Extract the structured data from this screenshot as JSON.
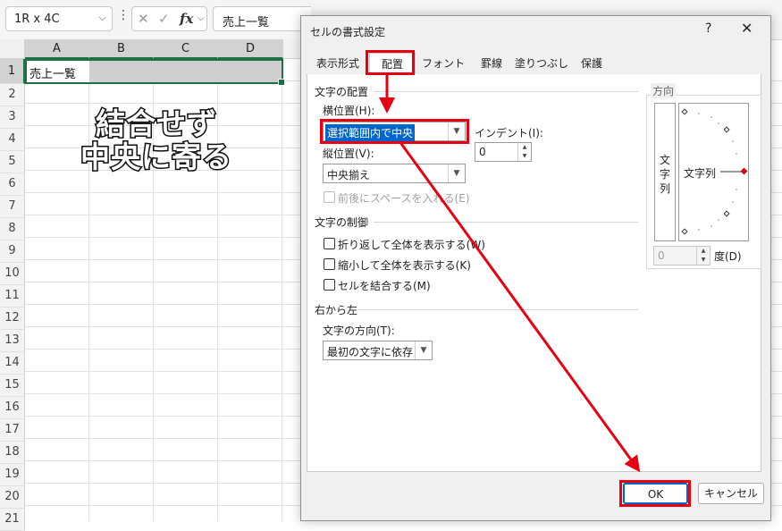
{
  "formula_bar": {
    "name_box": "1R x 4C",
    "more_icon": "⋮",
    "cancel_icon": "✕",
    "enter_icon": "✓",
    "fx": "fx",
    "formula": "売上一覧"
  },
  "sheet": {
    "columns": [
      "A",
      "B",
      "C",
      "D"
    ],
    "rows": [
      "1",
      "2",
      "3",
      "4",
      "5",
      "6",
      "7",
      "8",
      "9",
      "10",
      "11",
      "12",
      "13",
      "14",
      "15",
      "16",
      "17",
      "18",
      "19",
      "20",
      "21"
    ],
    "cell_a1": "売上一覧"
  },
  "annotation": {
    "line1": "結合せず",
    "line2": "中央に寄る"
  },
  "dialog": {
    "title": "セルの書式設定",
    "help": "?",
    "close": "✕",
    "tabs": [
      "表示形式",
      "配置",
      "フォント",
      "罫線",
      "塗りつぶし",
      "保護"
    ],
    "active_tab": "配置",
    "text_alignment": {
      "section": "文字の配置",
      "horizontal_label": "横位置(H):",
      "horizontal_value": "選択範囲内で中央",
      "indent_label": "インデント(I):",
      "indent_value": "0",
      "vertical_label": "縦位置(V):",
      "vertical_value": "中央揃え",
      "distributed_label": "前後にスペースを入れる(E)"
    },
    "text_control": {
      "section": "文字の制御",
      "wrap_label": "折り返して全体を表示する(W)",
      "shrink_label": "縮小して全体を表示する(K)",
      "merge_label": "セルを結合する(M)"
    },
    "rtl": {
      "section": "右から左",
      "direction_label": "文字の方向(T):",
      "direction_value": "最初の文字に依存"
    },
    "orientation": {
      "section": "方向",
      "vertical_chars": [
        "文",
        "字",
        "列"
      ],
      "dial_label": "文字列",
      "degrees_value": "0",
      "degrees_label": "度(D)"
    },
    "ok": "OK",
    "cancel": "キャンセル"
  },
  "colors": {
    "highlight": "#e60012",
    "selection": "#1e7145",
    "accent": "#0066cc"
  }
}
